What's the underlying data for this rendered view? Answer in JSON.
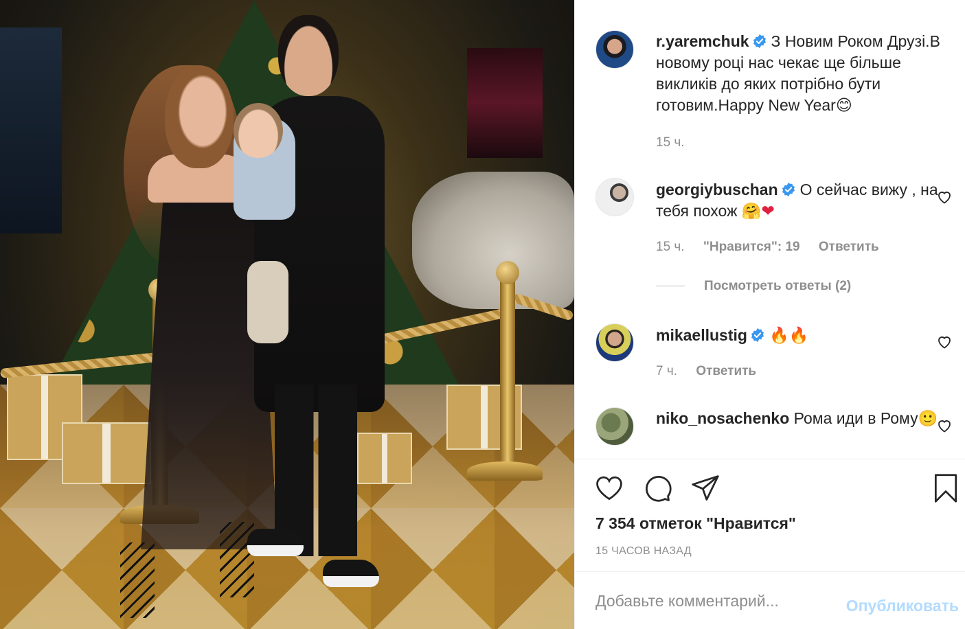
{
  "post": {
    "image_alt": "",
    "author": {
      "username": "r.yaremchuk",
      "verified": true,
      "avatar_icon": "profile-photo"
    },
    "caption": "З Новим Роком Друзі.В новому році нас чекає ще більше викликів до яких потрібно бути готовим.Happy New Year",
    "caption_emoji": "😊",
    "caption_time": "15 ч."
  },
  "comments": [
    {
      "username": "georgiybuschan",
      "verified": true,
      "text": "О сейчас вижу , на тебя похож",
      "emoji": "🤗❤",
      "time": "15 ч.",
      "likes_label": "\"Нравится\": 19",
      "reply_label": "Ответить",
      "view_replies_label": "Посмотреть ответы (2)"
    },
    {
      "username": "mikaellustig",
      "verified": true,
      "text": "",
      "emoji": "🔥🔥",
      "time": "7 ч.",
      "reply_label": "Ответить"
    },
    {
      "username": "niko_nosachenko",
      "verified": false,
      "text": "Рома иди в Рому",
      "emoji": "🙂"
    }
  ],
  "actions": {
    "like_icon": "heart-outline-icon",
    "comment_icon": "comment-bubble-icon",
    "share_icon": "paper-plane-icon",
    "save_icon": "bookmark-icon"
  },
  "likes_count": "7 354 отметок \"Нравится\"",
  "posted_ago": "15 ЧАСОВ НАЗАД",
  "comment_box": {
    "placeholder": "Добавьте комментарий...",
    "publish_label": "Опубликовать"
  },
  "colors": {
    "text": "#262626",
    "muted": "#8e8e8e",
    "verified_blue": "#3897f0",
    "publish_disabled": "#b3dbff",
    "heart_red": "#e0203f"
  }
}
